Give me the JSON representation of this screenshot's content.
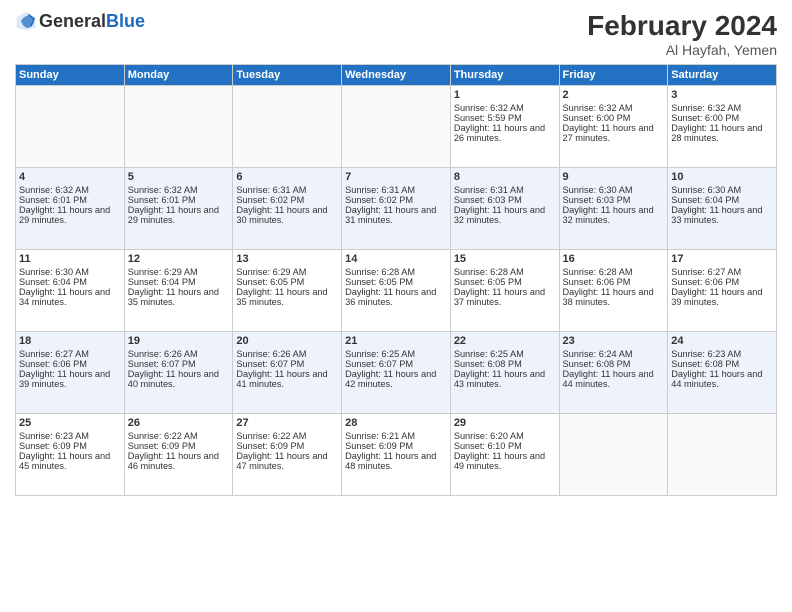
{
  "header": {
    "logo_general": "General",
    "logo_blue": "Blue",
    "title": "February 2024",
    "subtitle": "Al Hayfah, Yemen"
  },
  "days_of_week": [
    "Sunday",
    "Monday",
    "Tuesday",
    "Wednesday",
    "Thursday",
    "Friday",
    "Saturday"
  ],
  "weeks": [
    [
      {
        "day": "",
        "empty": true
      },
      {
        "day": "",
        "empty": true
      },
      {
        "day": "",
        "empty": true
      },
      {
        "day": "",
        "empty": true
      },
      {
        "day": "1",
        "sunrise": "Sunrise: 6:32 AM",
        "sunset": "Sunset: 5:59 PM",
        "daylight": "Daylight: 11 hours and 26 minutes."
      },
      {
        "day": "2",
        "sunrise": "Sunrise: 6:32 AM",
        "sunset": "Sunset: 6:00 PM",
        "daylight": "Daylight: 11 hours and 27 minutes."
      },
      {
        "day": "3",
        "sunrise": "Sunrise: 6:32 AM",
        "sunset": "Sunset: 6:00 PM",
        "daylight": "Daylight: 11 hours and 28 minutes."
      }
    ],
    [
      {
        "day": "4",
        "sunrise": "Sunrise: 6:32 AM",
        "sunset": "Sunset: 6:01 PM",
        "daylight": "Daylight: 11 hours and 29 minutes."
      },
      {
        "day": "5",
        "sunrise": "Sunrise: 6:32 AM",
        "sunset": "Sunset: 6:01 PM",
        "daylight": "Daylight: 11 hours and 29 minutes."
      },
      {
        "day": "6",
        "sunrise": "Sunrise: 6:31 AM",
        "sunset": "Sunset: 6:02 PM",
        "daylight": "Daylight: 11 hours and 30 minutes."
      },
      {
        "day": "7",
        "sunrise": "Sunrise: 6:31 AM",
        "sunset": "Sunset: 6:02 PM",
        "daylight": "Daylight: 11 hours and 31 minutes."
      },
      {
        "day": "8",
        "sunrise": "Sunrise: 6:31 AM",
        "sunset": "Sunset: 6:03 PM",
        "daylight": "Daylight: 11 hours and 32 minutes."
      },
      {
        "day": "9",
        "sunrise": "Sunrise: 6:30 AM",
        "sunset": "Sunset: 6:03 PM",
        "daylight": "Daylight: 11 hours and 32 minutes."
      },
      {
        "day": "10",
        "sunrise": "Sunrise: 6:30 AM",
        "sunset": "Sunset: 6:04 PM",
        "daylight": "Daylight: 11 hours and 33 minutes."
      }
    ],
    [
      {
        "day": "11",
        "sunrise": "Sunrise: 6:30 AM",
        "sunset": "Sunset: 6:04 PM",
        "daylight": "Daylight: 11 hours and 34 minutes."
      },
      {
        "day": "12",
        "sunrise": "Sunrise: 6:29 AM",
        "sunset": "Sunset: 6:04 PM",
        "daylight": "Daylight: 11 hours and 35 minutes."
      },
      {
        "day": "13",
        "sunrise": "Sunrise: 6:29 AM",
        "sunset": "Sunset: 6:05 PM",
        "daylight": "Daylight: 11 hours and 35 minutes."
      },
      {
        "day": "14",
        "sunrise": "Sunrise: 6:28 AM",
        "sunset": "Sunset: 6:05 PM",
        "daylight": "Daylight: 11 hours and 36 minutes."
      },
      {
        "day": "15",
        "sunrise": "Sunrise: 6:28 AM",
        "sunset": "Sunset: 6:05 PM",
        "daylight": "Daylight: 11 hours and 37 minutes."
      },
      {
        "day": "16",
        "sunrise": "Sunrise: 6:28 AM",
        "sunset": "Sunset: 6:06 PM",
        "daylight": "Daylight: 11 hours and 38 minutes."
      },
      {
        "day": "17",
        "sunrise": "Sunrise: 6:27 AM",
        "sunset": "Sunset: 6:06 PM",
        "daylight": "Daylight: 11 hours and 39 minutes."
      }
    ],
    [
      {
        "day": "18",
        "sunrise": "Sunrise: 6:27 AM",
        "sunset": "Sunset: 6:06 PM",
        "daylight": "Daylight: 11 hours and 39 minutes."
      },
      {
        "day": "19",
        "sunrise": "Sunrise: 6:26 AM",
        "sunset": "Sunset: 6:07 PM",
        "daylight": "Daylight: 11 hours and 40 minutes."
      },
      {
        "day": "20",
        "sunrise": "Sunrise: 6:26 AM",
        "sunset": "Sunset: 6:07 PM",
        "daylight": "Daylight: 11 hours and 41 minutes."
      },
      {
        "day": "21",
        "sunrise": "Sunrise: 6:25 AM",
        "sunset": "Sunset: 6:07 PM",
        "daylight": "Daylight: 11 hours and 42 minutes."
      },
      {
        "day": "22",
        "sunrise": "Sunrise: 6:25 AM",
        "sunset": "Sunset: 6:08 PM",
        "daylight": "Daylight: 11 hours and 43 minutes."
      },
      {
        "day": "23",
        "sunrise": "Sunrise: 6:24 AM",
        "sunset": "Sunset: 6:08 PM",
        "daylight": "Daylight: 11 hours and 44 minutes."
      },
      {
        "day": "24",
        "sunrise": "Sunrise: 6:23 AM",
        "sunset": "Sunset: 6:08 PM",
        "daylight": "Daylight: 11 hours and 44 minutes."
      }
    ],
    [
      {
        "day": "25",
        "sunrise": "Sunrise: 6:23 AM",
        "sunset": "Sunset: 6:09 PM",
        "daylight": "Daylight: 11 hours and 45 minutes."
      },
      {
        "day": "26",
        "sunrise": "Sunrise: 6:22 AM",
        "sunset": "Sunset: 6:09 PM",
        "daylight": "Daylight: 11 hours and 46 minutes."
      },
      {
        "day": "27",
        "sunrise": "Sunrise: 6:22 AM",
        "sunset": "Sunset: 6:09 PM",
        "daylight": "Daylight: 11 hours and 47 minutes."
      },
      {
        "day": "28",
        "sunrise": "Sunrise: 6:21 AM",
        "sunset": "Sunset: 6:09 PM",
        "daylight": "Daylight: 11 hours and 48 minutes."
      },
      {
        "day": "29",
        "sunrise": "Sunrise: 6:20 AM",
        "sunset": "Sunset: 6:10 PM",
        "daylight": "Daylight: 11 hours and 49 minutes."
      },
      {
        "day": "",
        "empty": true
      },
      {
        "day": "",
        "empty": true
      }
    ]
  ]
}
